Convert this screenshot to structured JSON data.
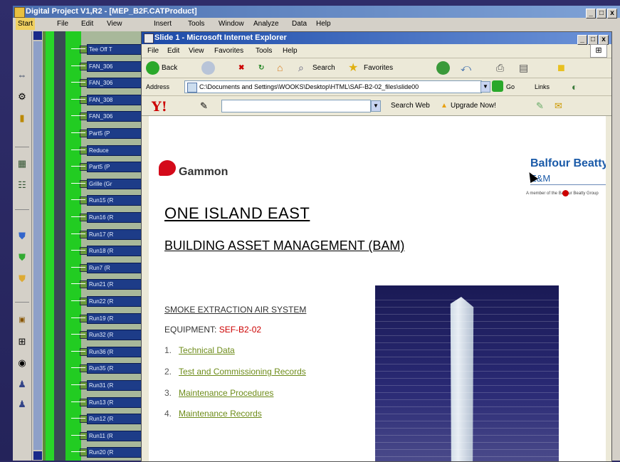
{
  "catia": {
    "title": "Digital Project V1,R2 - [MEP_B2F.CATProduct]",
    "window_controls": [
      "_",
      "□",
      "x"
    ],
    "menu": [
      "Start",
      "File",
      "Edit",
      "View",
      "Insert",
      "Tools",
      "Window",
      "Analyze",
      "Data",
      "Help"
    ],
    "tree_items": [
      "Tee Off T",
      "FAN_306",
      "FAN_306",
      "FAN_308",
      "FAN_306",
      "Part5 (P",
      "Reduce",
      "Part5 (P",
      "Grille (Gr",
      "Run15 (R",
      "Run16 (R",
      "Run17 (R",
      "Run18 (R",
      "Run7 (R",
      "Run21 (R",
      "Run22 (R",
      "Run19 (R",
      "Run32 (R",
      "Run36 (R",
      "Run35 (R",
      "Run31 (R",
      "Run13 (R",
      "Run12 (R",
      "Run11 (R",
      "Run20 (R"
    ],
    "toolbar_icons": [
      "view-icon",
      "tools-icon",
      "part-icon",
      "assembly-icon",
      "catalog-icon",
      "shield-blue-icon",
      "shield-green-icon",
      "shield-yellow-icon",
      "calendar-icon",
      "grid-icon",
      "measure-icon",
      "user-icon",
      "user2-icon"
    ]
  },
  "ie": {
    "title": "Slide 1 - Microsoft Internet Explorer",
    "menu": [
      "File",
      "Edit",
      "View",
      "Favorites",
      "Tools",
      "Help"
    ],
    "toolbar": {
      "back": "Back",
      "search": "Search",
      "favorites": "Favorites"
    },
    "address_label": "Address",
    "address": "C:\\Documents and Settings\\WOOKS\\Desktop\\HTML\\SAF-B2-02_files\\slide00",
    "go": "Go",
    "links": "Links",
    "yahoo": {
      "logo": "Y!",
      "search_web": "Search Web",
      "upgrade": "Upgrade Now!"
    }
  },
  "slide": {
    "gammon": "Gammon",
    "balfour": "Balfour Beatty",
    "em": "E&M",
    "bb_tagline": "A member of the Balfour Beatty Group",
    "title": "ONE ISLAND EAST",
    "subtitle": "BUILDING ASSET MANAGEMENT (BAM)",
    "system": "SMOKE EXTRACTION AIR SYSTEM",
    "equipment_label": "EQUIPMENT:",
    "equipment_code": "SEF-B2-02",
    "links": [
      {
        "num": "1.",
        "label": "Technical Data"
      },
      {
        "num": "2.",
        "label": "Test and Commissioning Records"
      },
      {
        "num": "3.",
        "label": "Maintenance Procedures"
      },
      {
        "num": "4.",
        "label": "Maintenance Records"
      }
    ]
  }
}
